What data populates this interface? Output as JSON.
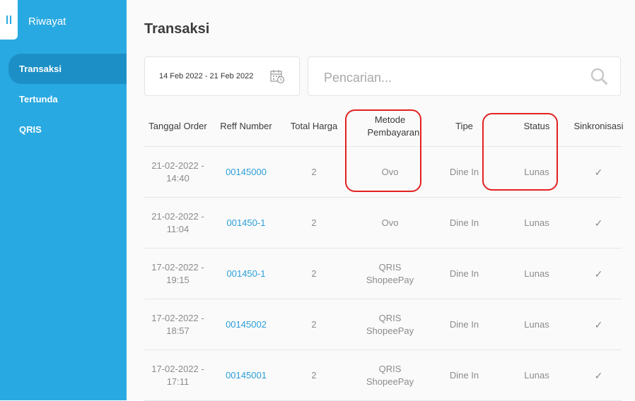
{
  "sidebar": {
    "title": "Riwayat",
    "items": [
      {
        "label": "Transaksi",
        "active": true
      },
      {
        "label": "Tertunda",
        "active": false
      },
      {
        "label": "QRIS",
        "active": false
      }
    ]
  },
  "main": {
    "title": "Transaksi",
    "date_range": "14 Feb 2022 - 21 Feb 2022",
    "search": {
      "placeholder": "Pencarian...",
      "value": ""
    },
    "table": {
      "headers": [
        "Tanggal Order",
        "Reff Number",
        "Total Harga",
        "Metode Pembayaran",
        "Tipe",
        "Status",
        "Sinkronisasi"
      ],
      "rows": [
        {
          "date": "21-02-2022 - 14:40",
          "reff": "00145000",
          "total": "2",
          "method": "Ovo",
          "type": "Dine In",
          "status": "Lunas",
          "sync": "✓"
        },
        {
          "date": "21-02-2022 - 11:04",
          "reff": "001450-1",
          "total": "2",
          "method": "Ovo",
          "type": "Dine In",
          "status": "Lunas",
          "sync": "✓"
        },
        {
          "date": "17-02-2022 - 19:15",
          "reff": "001450-1",
          "total": "2",
          "method": "QRIS ShopeePay",
          "type": "Dine In",
          "status": "Lunas",
          "sync": "✓"
        },
        {
          "date": "17-02-2022 - 18:57",
          "reff": "00145002",
          "total": "2",
          "method": "QRIS ShopeePay",
          "type": "Dine In",
          "status": "Lunas",
          "sync": "✓"
        },
        {
          "date": "17-02-2022 - 17:11",
          "reff": "00145001",
          "total": "2",
          "method": "QRIS ShopeePay",
          "type": "Dine In",
          "status": "Lunas",
          "sync": "✓"
        }
      ]
    }
  },
  "colors": {
    "sidebar": "#29a9e1",
    "sidebar_active": "#1c90c6",
    "link": "#2b9fd8",
    "highlight": "#e32121"
  },
  "icons": {
    "menu": "sidebar-toggle-icon",
    "calendar": "calendar-icon",
    "search": "search-icon",
    "check": "check-icon"
  }
}
